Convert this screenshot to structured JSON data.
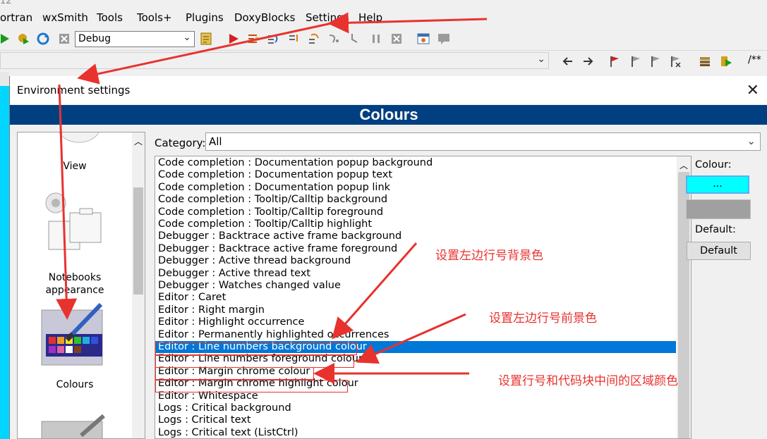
{
  "ide": {
    "title_fragment": "12",
    "menu": [
      "ortran",
      "wxSmith",
      "Tools",
      "Tools+",
      "Plugins",
      "DoxyBlocks",
      "Settings",
      "Help"
    ],
    "build_target": "Debug",
    "toolbar2_right_label": "/**"
  },
  "dialog": {
    "title": "Environment settings",
    "close_label": "✕",
    "header": "Colours",
    "left_items": [
      {
        "label": "View",
        "icon": "view-icon"
      },
      {
        "label": "Notebooks appearance",
        "icon": "notebooks-icon"
      },
      {
        "label": "Colours",
        "icon": "colours-icon"
      },
      {
        "label": "",
        "icon": "next-item-icon"
      }
    ],
    "category_label": "Category:",
    "category_value": "All",
    "rows": [
      "Code completion : Documentation popup background",
      "Code completion : Documentation popup text",
      "Code completion : Documentation popup link",
      "Code completion : Tooltip/Calltip background",
      "Code completion : Tooltip/Calltip foreground",
      "Code completion : Tooltip/Calltip highlight",
      "Debugger : Backtrace active frame background",
      "Debugger : Backtrace active frame foreground",
      "Debugger : Active thread background",
      "Debugger : Active thread text",
      "Debugger : Watches changed value",
      "Editor : Caret",
      "Editor : Right margin",
      "Editor : Highlight occurrence",
      "Editor : Permanently highlighted occurrences",
      "Editor : Line numbers background colour",
      "Editor : Line numbers foreground colour",
      "Editor : Margin chrome colour",
      "Editor : Margin chrome highlight colour",
      "Editor : Whitespace",
      "Logs : Critical background",
      "Logs : Critical text",
      "Logs : Critical text (ListCtrl)"
    ],
    "selected_row": "Editor : Line numbers background colour",
    "colour_label": "Colour:",
    "colour_button_label": "...",
    "colour_value": "#00ffff",
    "default_label": "Default:",
    "default_button_label": "Default"
  },
  "annotations": {
    "bg_note": "设置左边行号背景色",
    "fg_note": "设置左边行号前景色",
    "margin_note": "设置行号和代码块中间的区域颜色"
  },
  "colors": {
    "header_band": "#003f80",
    "selection": "#0078d7",
    "annotation": "#e8322e",
    "left_strip": "#00d6ff"
  }
}
